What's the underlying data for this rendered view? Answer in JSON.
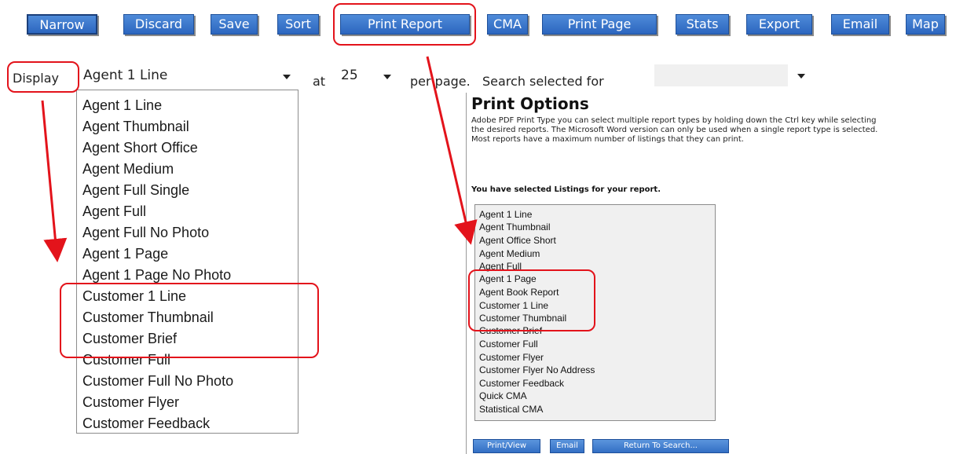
{
  "toolbar": {
    "narrow": "Narrow",
    "discard": "Discard",
    "save": "Save",
    "sort": "Sort",
    "print_report": "Print Report",
    "cma": "CMA",
    "print_page": "Print Page",
    "stats": "Stats",
    "export": "Export",
    "email": "Email",
    "map": "Map"
  },
  "display_row": {
    "display_label": "Display",
    "display_value": "Agent 1 Line",
    "at_label": "at",
    "per_page_value": "25",
    "per_page_text": "per page.",
    "search_label": "Search selected for",
    "search_value": ""
  },
  "display_options": [
    "Agent 1 Line",
    "Agent Thumbnail",
    "Agent Short Office",
    "Agent Medium",
    "Agent Full Single",
    "Agent Full",
    "Agent Full No Photo",
    "Agent 1 Page",
    "Agent 1 Page No Photo",
    "Customer 1 Line",
    "Customer Thumbnail",
    "Customer Brief",
    "Customer Full",
    "Customer Full No Photo",
    "Customer Flyer",
    "Customer Feedback"
  ],
  "print_options": {
    "title": "Print Options",
    "description_lines": [
      "Adobe PDF Print Type you can select multiple report types by holding down the Ctrl key while selecting",
      "the desired reports. The Microsoft Word version can only be used when a single report type is selected.",
      "Most reports have a maximum number of listings that they can print."
    ],
    "selected_text": "You have selected   Listings for your report.",
    "report_types": [
      "Agent 1 Line",
      "Agent Thumbnail",
      "Agent Office Short",
      "Agent Medium",
      "Agent Full",
      "Agent 1 Page",
      "Agent Book Report",
      "Customer 1 Line",
      "Customer Thumbnail",
      "Customer Brief",
      "Customer Full",
      "Customer Flyer",
      "Customer Flyer No Address",
      "Customer Feedback",
      "Quick CMA",
      "Statistical CMA"
    ],
    "buttons": {
      "print_view": "Print/View",
      "email": "Email",
      "return": "Return To Search..."
    }
  },
  "colors": {
    "button_blue": "#2c66bf",
    "highlight_red": "#e3131b"
  }
}
